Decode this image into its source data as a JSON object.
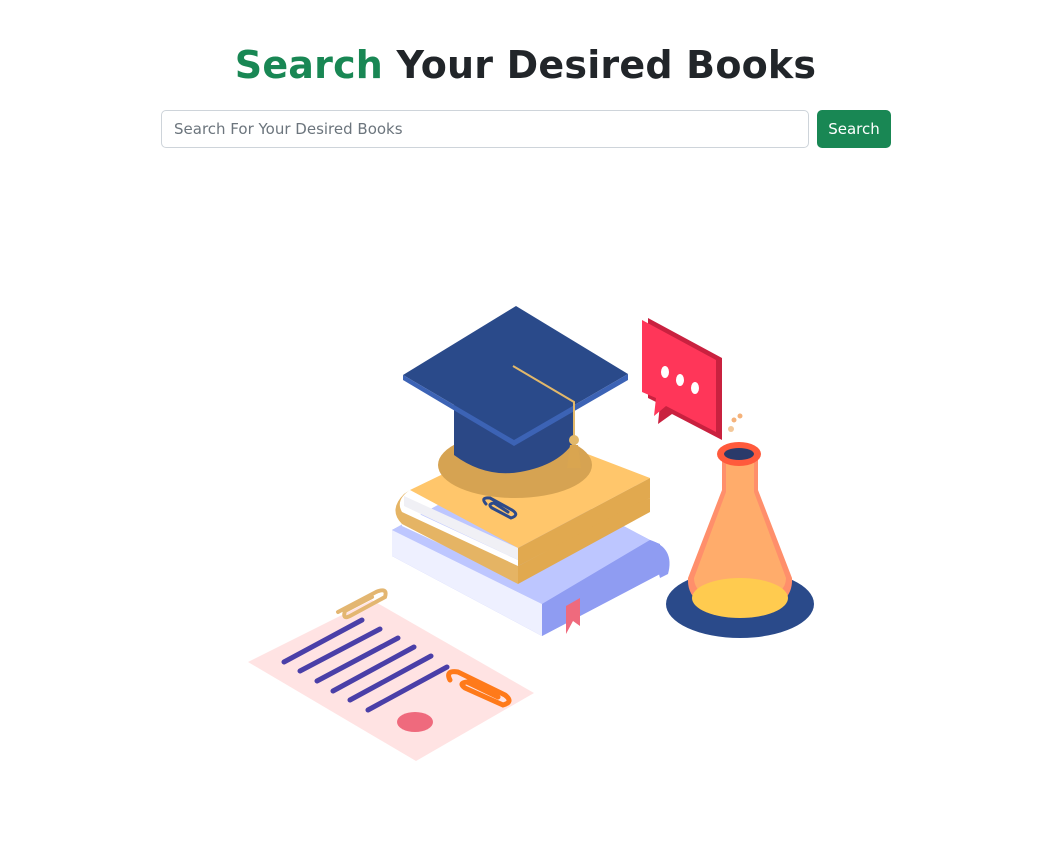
{
  "heading": {
    "accent": "Search",
    "rest": "Your Desired Books"
  },
  "search": {
    "placeholder": "Search For Your Desired Books",
    "value": "",
    "button_label": "Search"
  },
  "colors": {
    "accent": "#198754",
    "text": "#212529",
    "input_border": "#ced4da",
    "placeholder": "#6c757d"
  },
  "illustration": {
    "name": "education-books-illustration",
    "icons": [
      "graduation-cap-icon",
      "book-stack-icon",
      "chat-bubble-icon",
      "flask-icon",
      "document-icon",
      "paperclip-icon"
    ]
  }
}
